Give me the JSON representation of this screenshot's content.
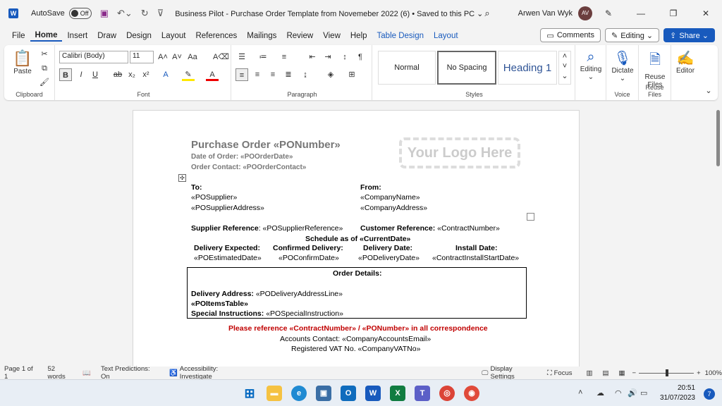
{
  "titlebar": {
    "app_icon": "W",
    "autosave_label": "AutoSave",
    "autosave_state": "Off",
    "doc_title": "Business Pilot - Purchase Order Template from Novemeber 2022 (6) • Saved to this PC ⌄",
    "user_name": "Arwen Van Wyk",
    "user_initials": "AV"
  },
  "tabs": [
    "File",
    "Home",
    "Insert",
    "Draw",
    "Design",
    "Layout",
    "References",
    "Mailings",
    "Review",
    "View",
    "Help",
    "Table Design",
    "Layout"
  ],
  "tabs_right": {
    "comments": "Comments",
    "editing": "Editing ⌄",
    "share": "Share ⌄"
  },
  "ribbon": {
    "clipboard": {
      "paste": "Paste",
      "label": "Clipboard"
    },
    "font": {
      "name": "Calibri (Body)",
      "size": "11",
      "label": "Font"
    },
    "paragraph": {
      "label": "Paragraph"
    },
    "styles": {
      "normal": "Normal",
      "no_spacing": "No Spacing",
      "heading1": "Heading 1",
      "label": "Styles"
    },
    "editing": "Editing",
    "dictate": "Dictate",
    "voice_label": "Voice",
    "reuse": "Reuse Files",
    "reuse_label": "Reuse Files",
    "editor": "Editor"
  },
  "document": {
    "title": "Purchase Order «PONumber»",
    "date_of_order": "Date of Order: «POOrderDate»",
    "order_contact": "Order Contact: «POOrderContact»",
    "logo": "Your Logo Here",
    "to_label": "To:",
    "supplier": "«POSupplier»",
    "supplier_address": "«POSupplierAddress»",
    "from_label": "From:",
    "company_name": "«CompanyName»",
    "company_address": "«CompanyAddress»",
    "supplier_ref_label": "Supplier Reference",
    "supplier_ref": ": «POSupplierReference»",
    "customer_ref_label": "Customer Reference:",
    "customer_ref": " «ContractNumber»",
    "schedule": "Schedule as of «CurrentDate»",
    "sched_headers": [
      "Delivery Expected:",
      "Confirmed Delivery:",
      "Delivery Date:",
      "Install Date:"
    ],
    "sched_values": [
      "«POEstimatedDate»",
      "«POConfirmDate»",
      "«PODeliveryDate»",
      "«ContractInstallStartDate»"
    ],
    "order_details": "Order Details:",
    "delivery_address_label": "Delivery Address:",
    "delivery_address": " «PODeliveryAddressLine»",
    "items_table": "«POItemsTable»",
    "special_label": "Special Instructions:",
    "special": " «POSpecialInstruction»",
    "reference_notice": "Please reference «ContractNumber» / «PONumber» in all correspondence",
    "accounts": "Accounts Contact: «CompanyAccountsEmail»",
    "vat": "Registered VAT No. «CompanyVATNo»"
  },
  "status": {
    "page": "Page 1 of 1",
    "words": "52 words",
    "predictions": "Text Predictions: On",
    "accessibility": "Accessibility: Investigate",
    "display": "Display Settings",
    "focus": "Focus",
    "zoom": "100%"
  },
  "taskbar": {
    "time": "20:51",
    "date": "31/07/2023",
    "notifications": "7"
  }
}
